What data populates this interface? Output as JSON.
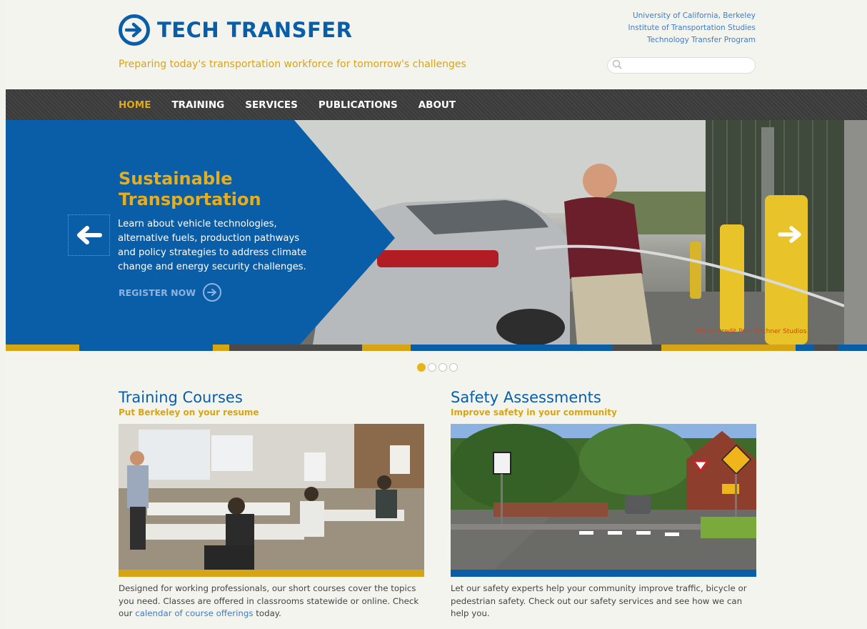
{
  "header": {
    "logo_text": "TECH TRANSFER",
    "tagline": "Preparing today's transportation workforce for tomorrow's challenges",
    "institution_lines": [
      "University of California, Berkeley",
      "Institute of Transportation Studies",
      "Technology Transfer Program"
    ],
    "search_placeholder": ""
  },
  "nav": {
    "items": [
      "HOME",
      "TRAINING",
      "SERVICES",
      "PUBLICATIONS",
      "ABOUT"
    ],
    "active_index": 0
  },
  "hero": {
    "title_line1": "Sustainable",
    "title_line2": "Transportation",
    "body": "Learn about vehicle technologies, alternative fuels, production pathways and policy strategies to address climate change and energy security challenges.",
    "cta": "REGISTER NOW",
    "photo_credit": "Photo: credit Paul Kirchner Studios",
    "slide_count": 4,
    "active_slide": 0
  },
  "columns": [
    {
      "title": "Training Courses",
      "subtitle": "Put Berkeley on your resume",
      "body_before": "Designed for working professionals, our short courses cover the topics you need. Classes are offered in classrooms statewide or online. Check our ",
      "link": "calendar of course offerings",
      "body_after": " today.",
      "bar_color": "#d7a414"
    },
    {
      "title": "Safety Assessments",
      "subtitle": "Improve safety in your community",
      "body_before": "Let our safety experts help your community improve traffic, bicycle or pedestrian safety. Check out our safety services and see how we can help you.",
      "link": "",
      "body_after": "",
      "bar_color": "#0a5ea8"
    }
  ],
  "colors": {
    "brand_blue": "#0a5ea8",
    "accent_gold": "#e7ad1b",
    "nav_bg": "#3f3f3f"
  },
  "icons": [
    "arrow-circle-logo-icon",
    "search-icon",
    "arrow-left-icon",
    "arrow-right-icon",
    "register-arrow-icon"
  ]
}
